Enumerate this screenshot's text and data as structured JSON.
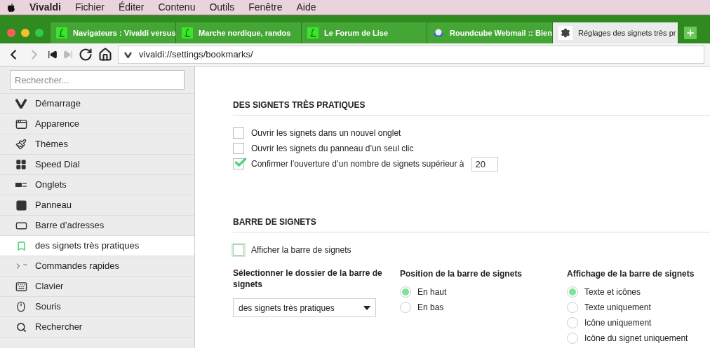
{
  "menu_bar": {
    "app": "Vivaldi",
    "items": [
      "Fichier",
      "Éditer",
      "Contenu",
      "Outils",
      "Fenêtre",
      "Aide"
    ]
  },
  "tabs": [
    {
      "title": "Navigateurs : Vivaldi versus",
      "kind": "forum",
      "selected": false
    },
    {
      "title": "Marche nordique, randos",
      "kind": "forum",
      "selected": false
    },
    {
      "title": "Le Forum de Lise",
      "kind": "forum",
      "selected": false
    },
    {
      "title": "Roundcube Webmail :: Bien",
      "kind": "webmail",
      "selected": false
    },
    {
      "title": "Réglages des signets très pr",
      "kind": "settings",
      "selected": true
    }
  ],
  "address_bar": {
    "url": "vivaldi://settings/bookmarks/"
  },
  "sidebar": {
    "search_placeholder": "Rechercher...",
    "items": [
      {
        "label": "Démarrage",
        "selected": false
      },
      {
        "label": "Apparence",
        "selected": false
      },
      {
        "label": "Thèmes",
        "selected": false
      },
      {
        "label": "Speed Dial",
        "selected": false
      },
      {
        "label": "Onglets",
        "selected": false
      },
      {
        "label": "Panneau",
        "selected": false
      },
      {
        "label": "Barre d’adresses",
        "selected": false
      },
      {
        "label": "des signets très pratiques",
        "selected": true
      },
      {
        "label": "Commandes rapides",
        "selected": false
      },
      {
        "label": "Clavier",
        "selected": false
      },
      {
        "label": "Souris",
        "selected": false
      },
      {
        "label": "Rechercher",
        "selected": false
      }
    ]
  },
  "bookmarks_section": {
    "title": "DES SIGNETS TRÈS PRATIQUES",
    "options": [
      {
        "label": "Ouvrir les signets dans un nouvel onglet",
        "checked": false
      },
      {
        "label": "Ouvrir les signets du panneau d’un seul clic",
        "checked": false
      },
      {
        "label": "Confirmer l’ouverture d’un nombre de signets supérieur à",
        "checked": true,
        "value": "20"
      }
    ]
  },
  "bookmark_bar_section": {
    "title": "BARRE DE SIGNETS",
    "show_bar": {
      "label": "Afficher la barre de signets",
      "checked": false,
      "focused": true
    },
    "folder": {
      "label": "Sélectionner le dossier de la barre de signets",
      "value": "des signets très pratiques"
    },
    "position": {
      "label": "Position de la barre de signets",
      "options": [
        {
          "label": "En haut",
          "selected": true
        },
        {
          "label": "En bas",
          "selected": false
        }
      ]
    },
    "display": {
      "label": "Affichage de la barre de signets",
      "options": [
        {
          "label": "Texte et icônes",
          "selected": true
        },
        {
          "label": "Texte uniquement",
          "selected": false
        },
        {
          "label": "Icône uniquement",
          "selected": false
        },
        {
          "label": "Icône du signet uniquement",
          "selected": false
        }
      ]
    }
  }
}
